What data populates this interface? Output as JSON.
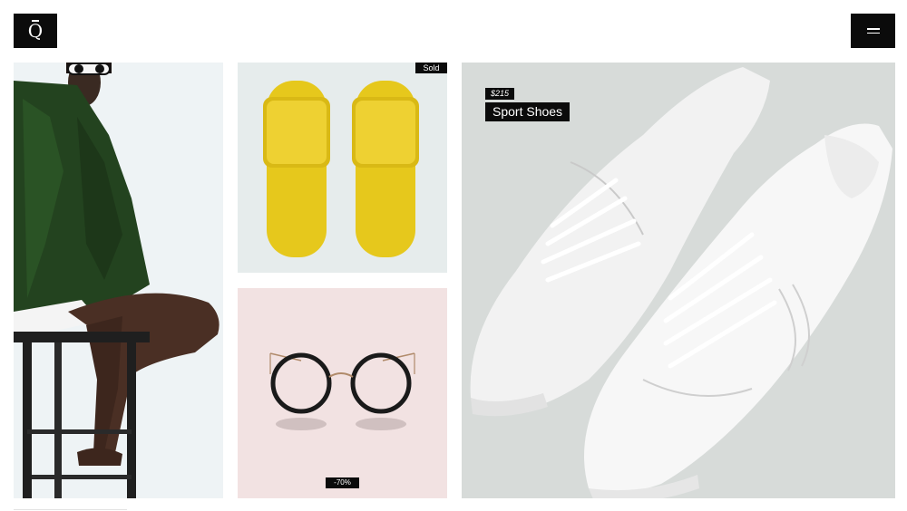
{
  "header": {
    "logo_letter": "Q",
    "menu_icon": "hamburger-icon"
  },
  "tiles": {
    "slides": {
      "badge": "Sold"
    },
    "glasses": {
      "badge": "-70%"
    },
    "shoes": {
      "price": "$215",
      "title": "Sport Shoes"
    }
  },
  "colors": {
    "accent": "#0b0b0b",
    "slides_yellow": "#e6c81c",
    "glasses_bg": "#f2e2e2",
    "slides_bg": "#e6ecec",
    "shoes_bg": "#d7dbd9"
  }
}
